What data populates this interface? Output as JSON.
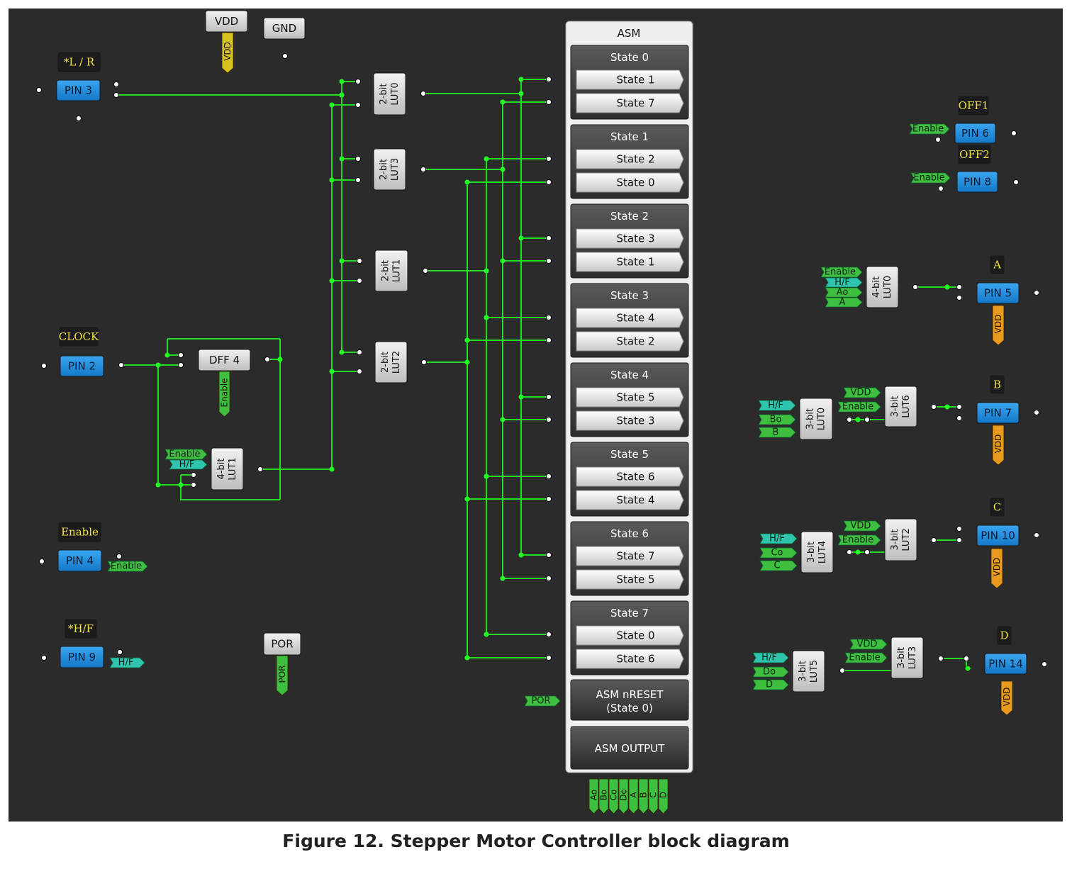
{
  "caption": "Figure 12. Stepper Motor Controller block diagram",
  "colors": {
    "background": "#2b2b2b",
    "wire": "#22dd22",
    "pin_blue": "#1e90e6",
    "gray_block": "#d4d4d4",
    "asm_panel": "#efefef",
    "asm_group": "#3a3a3a",
    "label_green": "#3fbf3f",
    "label_teal": "#2ec4b0",
    "vdd_yellow": "#d6c21e",
    "vdd_orange": "#e89a1e",
    "name_label_text": "#f0e040"
  },
  "pins": {
    "pin3": "PIN 3",
    "pin2": "PIN 2",
    "pin4": "PIN 4",
    "pin9": "PIN 9",
    "pin6": "PIN 6",
    "pin8": "PIN 8",
    "pin5": "PIN 5",
    "pin7": "PIN 7",
    "pin10": "PIN 10",
    "pin14": "PIN 14"
  },
  "pin_names": {
    "lr": "*L / R",
    "clock": "CLOCK",
    "enable": "Enable",
    "hf": "*H/F",
    "off1": "OFF1",
    "off2": "OFF2",
    "a": "A",
    "b": "B",
    "c": "C",
    "d": "D"
  },
  "blocks": {
    "vdd": "VDD",
    "gnd": "GND",
    "por": "POR",
    "dff4": "DFF 4",
    "lut0_2bit": "2-bit LUT0",
    "lut3_2bit": "2-bit LUT3",
    "lut1_2bit": "2-bit LUT1",
    "lut2_2bit": "2-bit LUT2",
    "lut1_4bit": "4-bit LUT1",
    "lut0_4bit": "4-bit LUT0",
    "lut0_3bit": "3-bit LUT0",
    "lut6_3bit": "3-bit LUT6",
    "lut4_3bit": "3-bit LUT4",
    "lut2_3bit": "3-bit LUT2",
    "lut5_3bit": "3-bit LUT5",
    "lut3_3bit": "3-bit LUT3"
  },
  "tags": {
    "vdd": "VDD",
    "enable": "Enable",
    "hf": "H/F",
    "por": "POR",
    "ao": "Ao",
    "a": "A",
    "bo": "Bo",
    "b": "B",
    "co": "Co",
    "c": "C",
    "do": "Do",
    "d": "D"
  },
  "asm": {
    "title": "ASM",
    "states": [
      {
        "name": "State 0",
        "transitions": [
          "State 1",
          "State 7"
        ]
      },
      {
        "name": "State 1",
        "transitions": [
          "State 2",
          "State 0"
        ]
      },
      {
        "name": "State 2",
        "transitions": [
          "State 3",
          "State 1"
        ]
      },
      {
        "name": "State 3",
        "transitions": [
          "State 4",
          "State 2"
        ]
      },
      {
        "name": "State 4",
        "transitions": [
          "State 5",
          "State 3"
        ]
      },
      {
        "name": "State 5",
        "transitions": [
          "State 6",
          "State 4"
        ]
      },
      {
        "name": "State 6",
        "transitions": [
          "State 7",
          "State 5"
        ]
      },
      {
        "name": "State 7",
        "transitions": [
          "State 0",
          "State 6"
        ]
      }
    ],
    "nreset_line1": "ASM nRESET",
    "nreset_line2": "(State 0)",
    "output_label": "ASM OUTPUT",
    "outputs": [
      "Ao",
      "Bo",
      "Co",
      "Do",
      "A",
      "B",
      "C",
      "D"
    ]
  }
}
